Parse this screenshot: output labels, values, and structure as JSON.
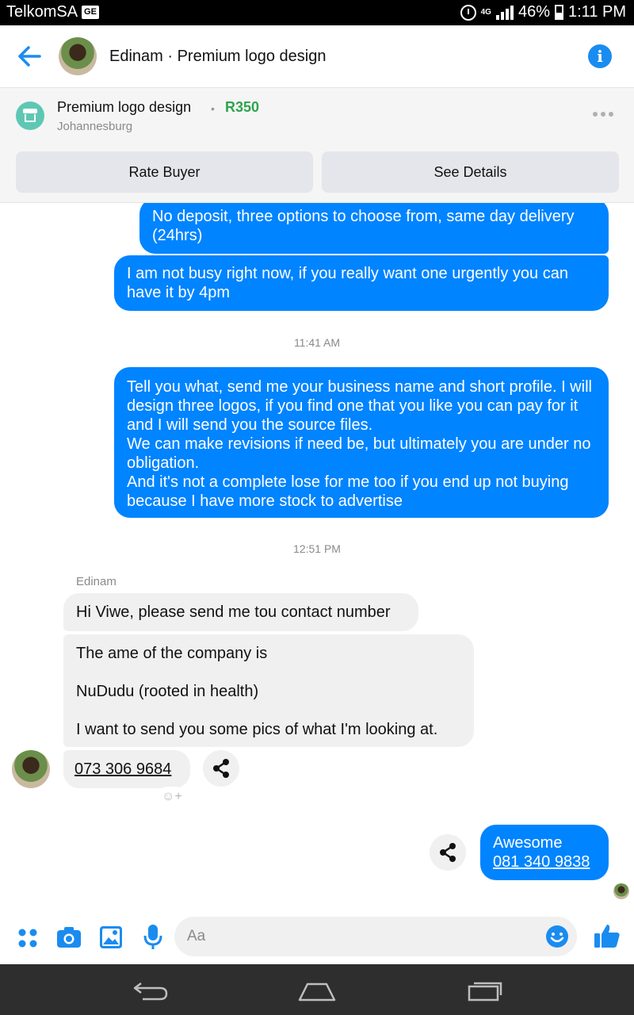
{
  "status_bar": {
    "carrier": "TelkomSA",
    "carrier_badge": "GE",
    "network": "4G",
    "battery": "46%",
    "time": "1:11 PM"
  },
  "header": {
    "title": "Edinam · Premium logo design",
    "back_icon": "arrow-left-icon",
    "info_icon": "info-icon"
  },
  "listing": {
    "title": "Premium logo design",
    "separator": "•",
    "price": "R350",
    "location": "Johannesburg",
    "rate_button": "Rate Buyer",
    "details_button": "See Details"
  },
  "messages": {
    "m1": "No deposit, three options to choose from, same day delivery (24hrs)",
    "m2": "I am not busy right now, if you really want one urgently you can have it by 4pm",
    "ts1": "11:41 AM",
    "m3": "Tell you what, send me your business name and short profile. I will design three logos, if you find one that you like you can pay for it and I will send you the source files.\nWe can make revisions if need be, but ultimately you are under no obligation.\nAnd it's not a complete lose for me too if you end up not buying because I have more stock to advertise",
    "ts2": "12:51 PM",
    "sender": "Edinam",
    "m4": "Hi Viwe, please send me tou contact number",
    "m5": "The  ame of the company is\n\n NuDudu (rooted in health)\n\nI want to send you some pics of what I'm looking at.",
    "m6": "073 306 9684",
    "m7_line1": "Awesome",
    "m7_line2": "081 340 9838"
  },
  "composer": {
    "placeholder": "Aa"
  },
  "colors": {
    "accent": "#0084ff",
    "price": "#2ea44f",
    "incoming_bubble": "#f1f0f0"
  }
}
